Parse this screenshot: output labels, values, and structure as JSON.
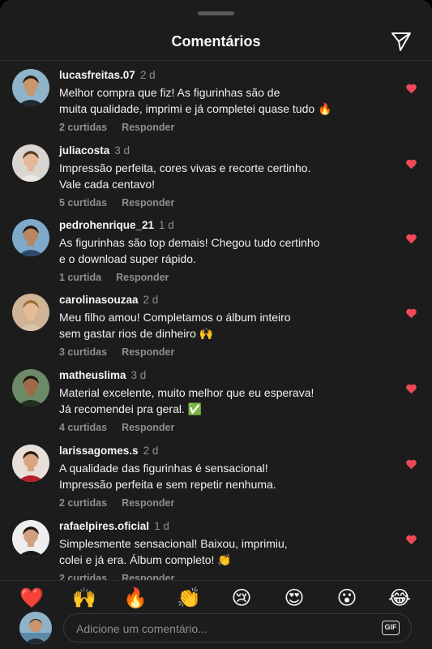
{
  "header": {
    "title": "Comentários",
    "share_icon": "send-icon"
  },
  "comments": [
    {
      "user": "lucasfreitas.07",
      "time": "2 d",
      "text": [
        "Melhor compra que fiz! As figurinhas são de",
        "muita qualidade, imprimi e já completei quase tudo 🔥"
      ],
      "likes": "2 curtidas",
      "reply": "Responder",
      "skin": "#c8956c",
      "hair": "#2a1d14",
      "shirt": "#1e2a36",
      "bg": "#8fb3c9"
    },
    {
      "user": "juliacosta",
      "time": "3 d",
      "text": [
        "Impressão perfeita, cores vivas e recorte certinho.",
        "Vale cada centavo!"
      ],
      "likes": "5 curtidas",
      "reply": "Responder",
      "skin": "#e3b99a",
      "hair": "#5a3a24",
      "shirt": "#ece7e1",
      "bg": "#d9d5d0"
    },
    {
      "user": "pedrohenrique_21",
      "time": "1 d",
      "text": [
        "As figurinhas são top demais! Chegou tudo certinho",
        "e o download super rápido."
      ],
      "likes": "1 curtida",
      "reply": "Responder",
      "skin": "#b98460",
      "hair": "#231812",
      "shirt": "#2b4a6e",
      "bg": "#7fa9c8"
    },
    {
      "user": "carolinasouzaa",
      "time": "2 d",
      "text": [
        "Meu filho amou! Completamos o álbum inteiro",
        "sem gastar rios de dinheiro 🙌"
      ],
      "likes": "3 curtidas",
      "reply": "Responder",
      "skin": "#e6bb96",
      "hair": "#9c6b3c",
      "shirt": "#d9c3a9",
      "bg": "#cfb595"
    },
    {
      "user": "matheuslima",
      "time": "3 d",
      "text": [
        "Material excelente, muito melhor que eu esperava!",
        "Já recomendei pra geral. ✅"
      ],
      "likes": "4 curtidas",
      "reply": "Responder",
      "skin": "#9c6a48",
      "hair": "#1a1410",
      "shirt": "#22301f",
      "bg": "#6d8a66"
    },
    {
      "user": "larissagomes.s",
      "time": "2 d",
      "text": [
        "A qualidade das figurinhas é sensacional!",
        "Impressão perfeita e sem repetir nenhuma."
      ],
      "likes": "2 curtidas",
      "reply": "Responder",
      "skin": "#d8a582",
      "hair": "#2c1a12",
      "shirt": "#b81d2c",
      "bg": "#e8dfd9"
    },
    {
      "user": "rafaelpires.oficial",
      "time": "1 d",
      "text": [
        "Simplesmente sensacional! Baixou, imprimiu,",
        "colei e já era. Álbum completo! 👏"
      ],
      "likes": "2 curtidas",
      "reply": "Responder",
      "skin": "#d0a080",
      "hair": "#1c1410",
      "shirt": "#1a1a1a",
      "bg": "#eeeeee"
    }
  ],
  "like_color": "#ed4956",
  "reactions": [
    "❤️",
    "🙌",
    "🔥",
    "👏",
    "😢",
    "😍",
    "😮",
    "😂"
  ],
  "composer": {
    "placeholder": "Adicione um comentário...",
    "gif_label": "GIF"
  }
}
